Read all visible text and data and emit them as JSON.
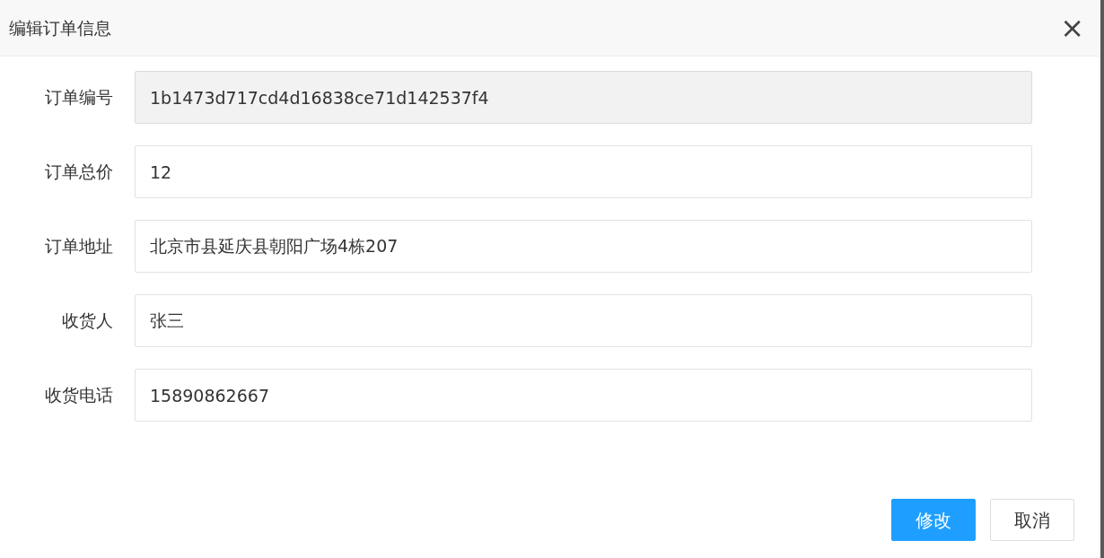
{
  "dialog": {
    "title": "编辑订单信息",
    "close": "×"
  },
  "fields": [
    {
      "label": "订单编号",
      "value": "1b1473d717cd4d16838ce71d142537f4",
      "disabled": true
    },
    {
      "label": "订单总价",
      "value": "12",
      "disabled": false
    },
    {
      "label": "订单地址",
      "value": "北京市县延庆县朝阳广场4栋207",
      "disabled": false
    },
    {
      "label": "收货人",
      "value": "张三",
      "disabled": false
    },
    {
      "label": "收货电话",
      "value": "15890862667",
      "disabled": false
    }
  ],
  "buttons": [
    {
      "label": "修改",
      "kind": "primary"
    },
    {
      "label": "取消",
      "kind": "default"
    }
  ]
}
